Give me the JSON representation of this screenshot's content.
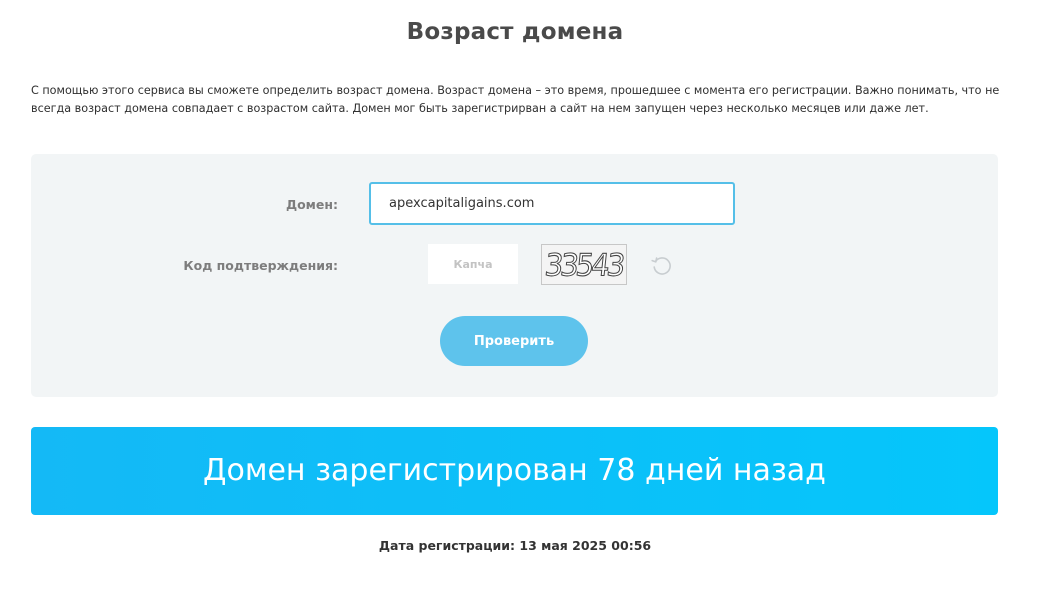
{
  "page": {
    "title": "Возраст домена",
    "description": "С помощью этого сервиса вы сможете определить возраст домена. Возраст домена – это время, прошедшее с момента его регистрации. Важно понимать, что не всегда возраст домена совпадает с возрастом сайта. Домен мог быть зарегистрирван а сайт на нем запущен через несколько месяцев или даже лет."
  },
  "form": {
    "domain_label": "Домен:",
    "domain_value": "apexcapitaligains.com",
    "captcha_label": "Код подтверждения:",
    "captcha_placeholder": "Капча",
    "captcha_code": "33543",
    "refresh_icon": "refresh-icon",
    "submit_label": "Проверить"
  },
  "result": {
    "message": "Домен зарегистрирован 78 дней назад",
    "registration_date": "Дата регистрации: 13 мая 2025 00:56"
  },
  "colors": {
    "accent": "#55bfe8",
    "button": "#5ec3ec",
    "banner_start": "#14b9f6",
    "banner_end": "#05c6fb",
    "panel": "#f2f5f6"
  }
}
